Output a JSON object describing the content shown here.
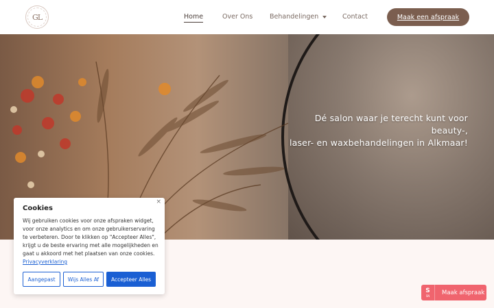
{
  "header": {
    "logo_text": "GL",
    "nav": {
      "home": "Home",
      "over_ons": "Over Ons",
      "behandelingen": "Behandelingen",
      "contact": "Contact"
    },
    "cta_label": "Maak een afspraak"
  },
  "hero": {
    "line1": "Dé salon waar je terecht kunt voor beauty-,",
    "line2": "laser- en waxbehandelingen in Alkmaar!"
  },
  "cookie": {
    "close": "×",
    "title": "Cookies",
    "text": "Wij gebruiken cookies voor onze afspraken widget, voor onze analytics en om onze gebruikerservaring te verbeteren. Door te klikken op \"Accepteer Alles\", krijgt u de beste ervaring met alle mogelijkheden en gaat u akkoord met het plaatsen van onze cookies.",
    "link": "Privacyverklaring",
    "btn_custom": "Aangepast",
    "btn_reject": "Wijs Alles Af",
    "btn_accept": "Accepteer Alles"
  },
  "floating_booking": {
    "icon_letter": "S",
    "icon_sub": "SN",
    "label": "Maak afspraak"
  },
  "colors": {
    "cta": "#7b5e4f",
    "accent_blue": "#1a5fd3",
    "booking": "#f0646e"
  }
}
